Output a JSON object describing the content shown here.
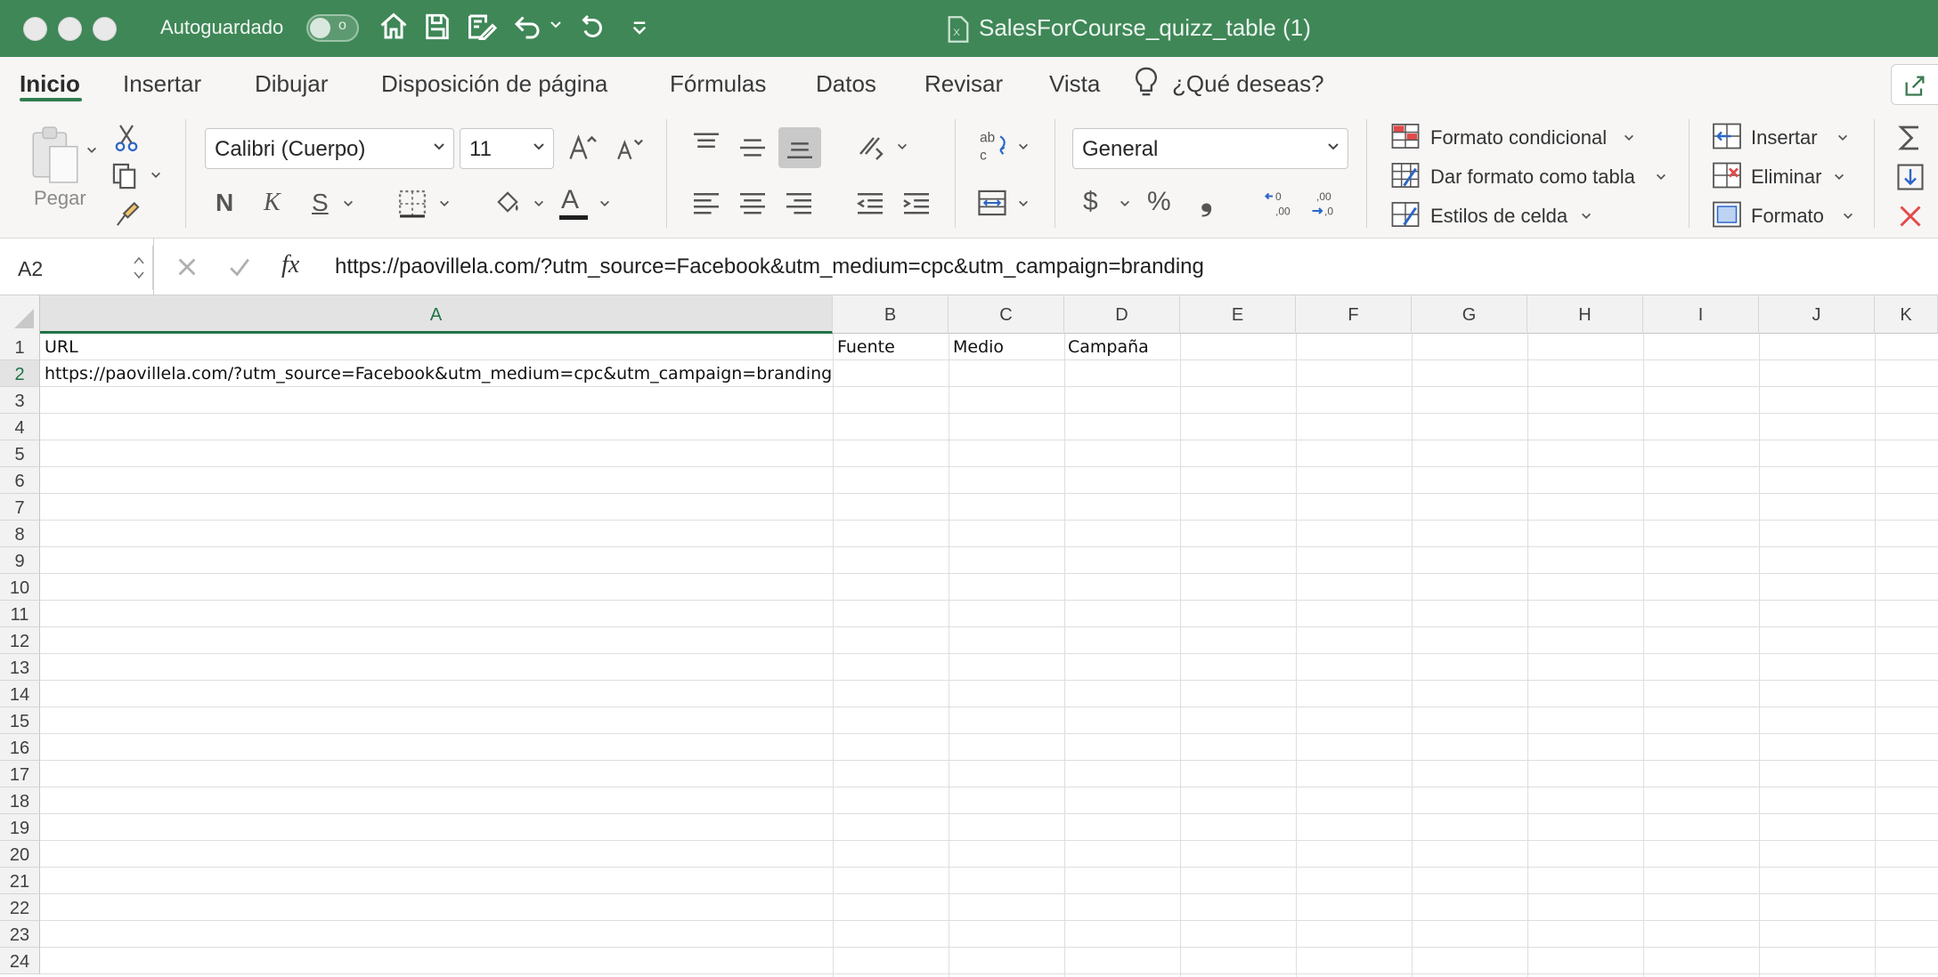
{
  "titlebar": {
    "autosave_label": "Autoguardado",
    "toggle_state": "o",
    "doc_title": "SalesForCourse_quizz_table (1)",
    "bg_color": "#3f8757"
  },
  "tabs": [
    {
      "label": "Inicio",
      "active": true
    },
    {
      "label": "Insertar"
    },
    {
      "label": "Dibujar"
    },
    {
      "label": "Disposición de página"
    },
    {
      "label": "Fórmulas"
    },
    {
      "label": "Datos"
    },
    {
      "label": "Revisar"
    },
    {
      "label": "Vista"
    }
  ],
  "tell_me": "¿Qué deseas?",
  "ribbon": {
    "paste_label": "Pegar",
    "font_name": "Calibri (Cuerpo)",
    "font_size": "11",
    "bold": "N",
    "italic": "K",
    "underline": "S",
    "font_color_glyph": "A",
    "number_format": "General",
    "currency": "$",
    "percent": "%",
    "comma": "❟",
    "styles": {
      "conditional": "Formato condicional",
      "as_table": "Dar formato como tabla",
      "cell_styles": "Estilos de celda"
    },
    "cells": {
      "insert": "Insertar",
      "delete": "Eliminar",
      "format": "Formato"
    }
  },
  "formula_bar": {
    "name_box": "A2",
    "fx": "fx",
    "content": "https://paovillela.com/?utm_source=Facebook&utm_medium=cpc&utm_campaign=branding"
  },
  "grid": {
    "columns": [
      "A",
      "B",
      "C",
      "D",
      "E",
      "F",
      "G",
      "H",
      "I",
      "J",
      "K"
    ],
    "selected_column": "A",
    "selected_row": 2,
    "rows": [
      "1",
      "2",
      "3",
      "4",
      "5",
      "6",
      "7",
      "8",
      "9",
      "10",
      "11",
      "12",
      "13",
      "14",
      "15",
      "16",
      "17",
      "18",
      "19",
      "20",
      "21",
      "22",
      "23",
      "24"
    ],
    "cells": {
      "A1": "URL",
      "B1": "Fuente",
      "C1": "Medio",
      "D1": "Campaña",
      "A2": "https://paovillela.com/?utm_source=Facebook&utm_medium=cpc&utm_campaign=branding"
    }
  }
}
